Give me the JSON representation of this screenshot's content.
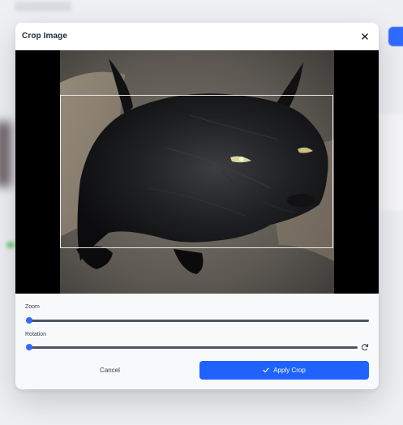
{
  "dialog": {
    "title": "Crop Image"
  },
  "controls": {
    "zoom_label": "Zoom",
    "zoom_value": 0,
    "rotation_label": "Rotation",
    "rotation_value": 0
  },
  "actions": {
    "cancel_label": "Cancel",
    "apply_label": "Apply Crop"
  },
  "colors": {
    "accent": "#1f62ff",
    "track": "#4b5563",
    "backdrop": "#000000"
  },
  "icons": {
    "close": "close-icon",
    "check": "check-icon",
    "rotate_reset": "rotate-reset-icon"
  }
}
